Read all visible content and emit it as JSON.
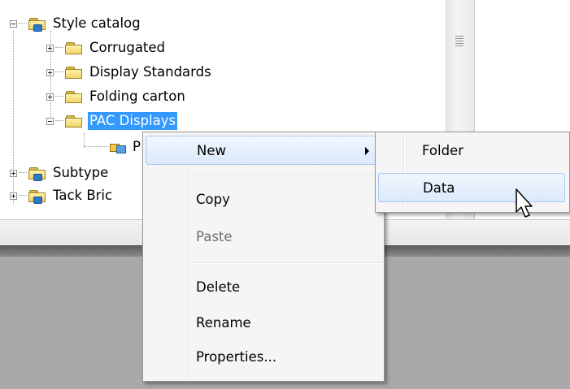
{
  "tree": {
    "nodes": [
      {
        "label": "Style catalog",
        "icon": "catalog-folder-icon",
        "expander": "minus"
      },
      {
        "label": "Corrugated",
        "icon": "folder-icon",
        "expander": "plus"
      },
      {
        "label": "Display Standards",
        "icon": "folder-icon",
        "expander": "plus"
      },
      {
        "label": "Folding carton",
        "icon": "folder-icon",
        "expander": "plus"
      },
      {
        "label": "PAC Displays",
        "icon": "folder-open-icon",
        "expander": "minus",
        "selected": true
      },
      {
        "label": "P",
        "icon": "data-icon"
      },
      {
        "label": "Subtype",
        "icon": "catalog-folder-icon",
        "expander": "plus"
      },
      {
        "label": "Tack Bric",
        "icon": "catalog-folder-icon",
        "expander": "plus"
      }
    ]
  },
  "context_menu": {
    "new": "New",
    "copy": "Copy",
    "paste": "Paste",
    "delete": "Delete",
    "rename": "Rename",
    "properties": "Properties..."
  },
  "submenu": {
    "folder": "Folder",
    "data": "Data"
  },
  "colors": {
    "selection": "#3399ff",
    "menu_background": "#f5f5f5",
    "hover_border": "#a8c8ef",
    "lower_area": "#a9a9a9"
  }
}
